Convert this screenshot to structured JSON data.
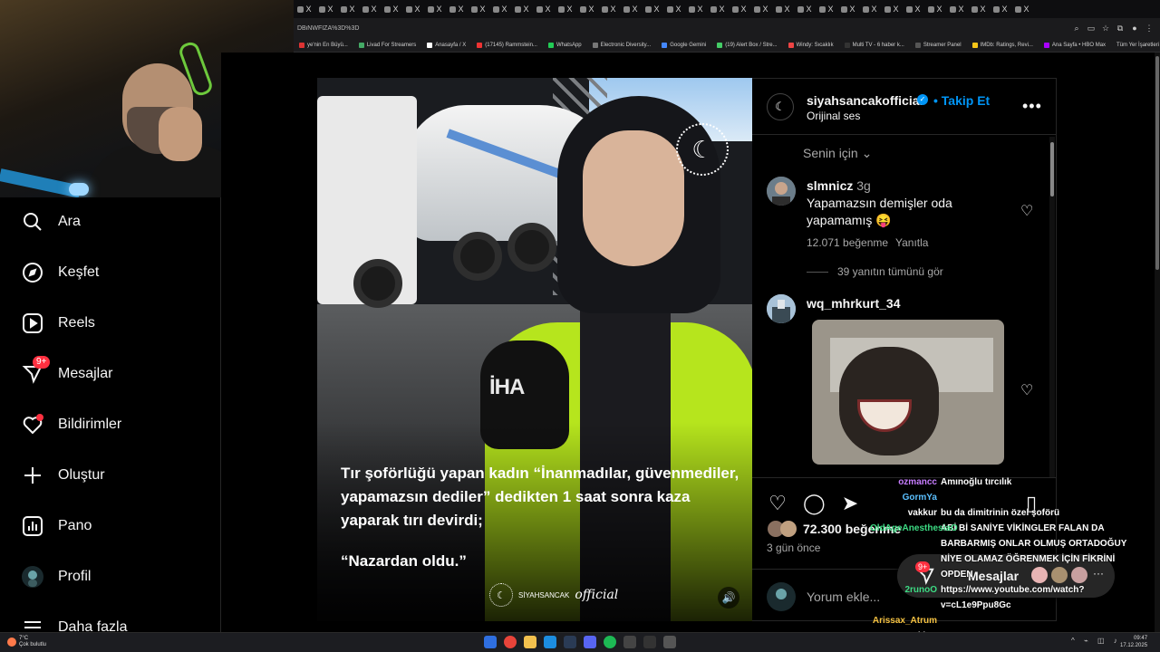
{
  "browser": {
    "tabs": [
      "X",
      "X",
      "X",
      "X",
      "X",
      "X",
      "X",
      "X",
      "X",
      "X",
      "X",
      "X",
      "X",
      "X",
      "X",
      "X",
      "X",
      "X",
      "X",
      "X",
      "X",
      "X",
      "X",
      "X",
      "X",
      "X",
      "X",
      "X",
      "X",
      "X",
      "X",
      "X",
      "X",
      "X"
    ],
    "url": "DBiNWFIZA%3D%3D",
    "bookmarks": [
      "ye'nin En Büyü...",
      "Livad For Streamers",
      "Anasayfa / X",
      "(17145) Rammstein...",
      "WhatsApp",
      "Electronic Diversity...",
      "Google Gemini",
      "(19) Alert Box / Stre...",
      "Windy: Sıcaklık",
      "Multi TV - 6 haber k...",
      "Streamer Panel",
      "IMDb: Ratings, Revi...",
      "Ana Sayfa • HBO Max"
    ],
    "all_bookmarks": "Tüm Yer İşaretleri"
  },
  "sidebar": {
    "items": [
      {
        "label": "Ara",
        "icon": "search-icon"
      },
      {
        "label": "Keşfet",
        "icon": "compass-icon"
      },
      {
        "label": "Reels",
        "icon": "reels-icon"
      },
      {
        "label": "Mesajlar",
        "icon": "messenger-icon",
        "badge": "9+"
      },
      {
        "label": "Bildirimler",
        "icon": "heart-icon"
      },
      {
        "label": "Oluştur",
        "icon": "plus-icon"
      },
      {
        "label": "Pano",
        "icon": "dashboard-icon"
      },
      {
        "label": "Profil",
        "icon": "profile-avatar-icon"
      },
      {
        "label": "Daha fazla",
        "icon": "menu-icon"
      }
    ]
  },
  "video": {
    "caption_main": "Tır şoförlüğü yapan kadın “İnanmadılar, güvenmediler, yapamazsın dediler” dedikten 1 saat sonra kaza yaparak tırı devirdi;",
    "caption_quote": "“Nazardan oldu.”",
    "mic_brand": "İHA",
    "logo_text": "SİYAHSANCAK",
    "logo_script": "official"
  },
  "post": {
    "username": "siyahsancakofficial",
    "follow_label": "Takip Et",
    "separator": "•",
    "audio": "Orijinal ses",
    "sort_label": "Senin için",
    "likes": "72.300 beğenme",
    "date": "3 gün önce",
    "comment_placeholder": "Yorum ekle...",
    "comments": [
      {
        "user": "slmnicz",
        "time": "3g",
        "text": "Yapamazsın demişler oda yapamamış 😝",
        "likes": "12.071 beğenme",
        "reply": "Yanıtla"
      },
      {
        "user": "wq_mhrkurt_34"
      }
    ],
    "view_replies": "39 yanıtın tümünü gör"
  },
  "chat": {
    "lines": [
      {
        "name": "ozmancc",
        "msg": "Amınoğlu tırcılık",
        "color": "#c77dff"
      },
      {
        "name": "GormYa",
        "msg": "",
        "color": "#5bc0ff"
      },
      {
        "name": "vakkur",
        "msg": "bu da dimitrinin özel şoförü",
        "color": "#ffffff"
      },
      {
        "name": "",
        "msg": "ABİ Bİ SANİYE VİKİNGLER FALAN DA BARBARMIŞ ONLAR OLMUŞ ORTADOĞUY NİYE OLAMAZ ÖĞRENMEK İÇİN FİKRİNİ OPDEN",
        "color": "#ffffff"
      },
      {
        "name": "OldAgeAnesthesiaO",
        "msg": "",
        "color": "#3ddc84"
      },
      {
        "name": "2runoO",
        "msg": "https://www.youtube.com/watch?v=cL1e9Ppu8Gc",
        "color": "#3ddc84"
      },
      {
        "name": "Arissax_Atrum",
        "msg": "",
        "color": "#f5c242"
      },
      {
        "name": "vakkur",
        "msg": "",
        "color": "#ffffff"
      }
    ],
    "messages_pill": "Mesajlar",
    "messages_badge": "9+"
  },
  "taskbar": {
    "temp": "7°C",
    "weather": "Çok bulutlu",
    "time": "09:47",
    "date": "17.12.2025"
  },
  "colors": {
    "accent": "#0095f6",
    "notification": "#ff3040",
    "vest": "#b6e51d"
  }
}
